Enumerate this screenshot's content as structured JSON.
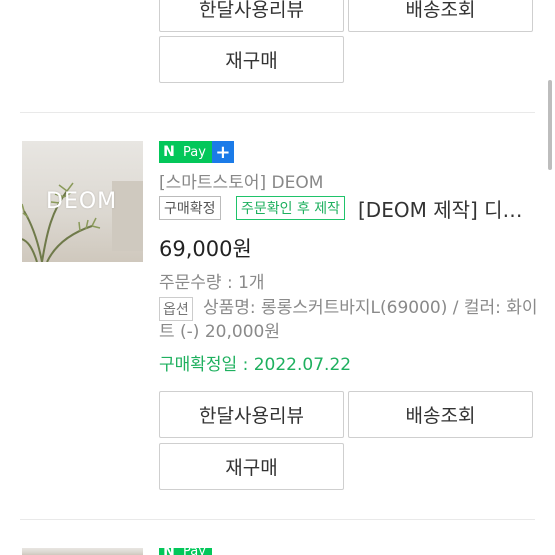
{
  "top_item": {
    "review_button": "한달사용리뷰",
    "track_button": "배송조회",
    "rebuy_button": "재구매"
  },
  "order": {
    "thumb_logo": "DEOM",
    "npay_n": "N",
    "npay_label": "Pay",
    "npay_plus": "+",
    "store": "[스마트스토어] DEOM",
    "status_badge": "구매확정",
    "custom_badge": "주문확인 후 제작",
    "product_title": "[DEOM 제작] 디…",
    "price": "69,000원",
    "quantity": "주문수량 : 1개",
    "option_tag": "옵션",
    "option_text": "상품명: 롱롱스커트바지L(69000) / 컬러: 화이트 (-) 20,000원",
    "confirm_date": "구매확정일 : 2022.07.22",
    "review_button": "한달사용리뷰",
    "track_button": "배송조회",
    "rebuy_button": "재구매"
  },
  "next_item": {
    "npay_n": "N",
    "npay_label": "Pay"
  },
  "colors": {
    "npay_green": "#03c75a",
    "npay_blue": "#1b7be8",
    "confirm_green": "#1fb05f"
  }
}
